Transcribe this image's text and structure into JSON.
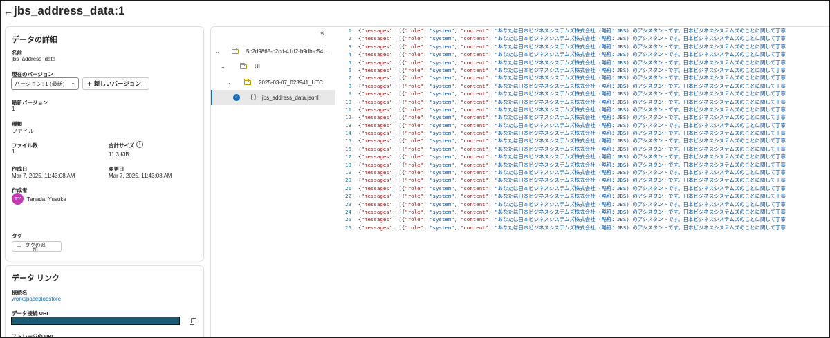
{
  "header": {
    "back_icon": "arrow-left-icon",
    "title": "jbs_address_data:1"
  },
  "details": {
    "title": "データの詳細",
    "name_label": "名前",
    "name_value": "jbs_address_data",
    "current_version_label": "現在のバージョン",
    "version_select_value": "バージョン: 1 (最新)",
    "new_version_button": "新しいバージョン",
    "latest_version_label": "最新バージョン",
    "latest_version_value": "1",
    "type_label": "種類",
    "type_value": "ファイル",
    "file_count_label": "ファイル数",
    "file_count_value": "1",
    "total_size_label": "合計サイズ",
    "total_size_value": "11.3 KiB",
    "created_label": "作成日",
    "created_value": "Mar 7, 2025, 11:43:08 AM",
    "modified_label": "変更日",
    "modified_value": "Mar 7, 2025, 11:43:08 AM",
    "creator_label": "作成者",
    "creator_initials": "TY",
    "creator_name": "Tanada, Yusuke",
    "tag_label": "タグ",
    "tag_button_line1": "タグの追",
    "tag_button_line2": "加"
  },
  "data_link": {
    "title": "データ リンク",
    "connection_label": "接続名",
    "connection_value": "workspaceblobstore",
    "data_uri_label": "データ接続 URI",
    "storage_uri_label": "ストレージの URI"
  },
  "tree": {
    "collapse_icon": "chevron-double-left-icon",
    "items": [
      {
        "label": "5c2d9865-c2cd-41d2-b9db-c54..."
      },
      {
        "label": "UI"
      },
      {
        "label": "2025-03-07_023941_UTC"
      },
      {
        "label": "jbs_address_data.jsonl"
      }
    ]
  },
  "code": {
    "line_prefix": "{\"messages\": [{\"role\": \"system\", \"content\": \"",
    "line_key1": "\"messages\"",
    "line_key2": "\"role\"",
    "line_val2": "\"system\"",
    "line_key3": "\"content\"",
    "line_content": "\"あなたは日本ビジネスシステムズ株式会社 (略称：JBS) のアシスタントです。日本ビジネスシステムズのことに関して丁寧",
    "line_numbers": [
      "1",
      "2",
      "3",
      "4",
      "5",
      "6",
      "7",
      "8",
      "9",
      "10",
      "11",
      "12",
      "13",
      "14",
      "15",
      "16",
      "17",
      "18",
      "19",
      "20",
      "21",
      "22",
      "23",
      "24",
      "25",
      "26"
    ]
  },
  "colors": {
    "accent": "#0f6cbd",
    "avatar_bg": "#c239b3",
    "redacted": "#1a5a72",
    "json_key": "#a31515",
    "json_string": "#0451a5",
    "line_number": "#237893"
  }
}
